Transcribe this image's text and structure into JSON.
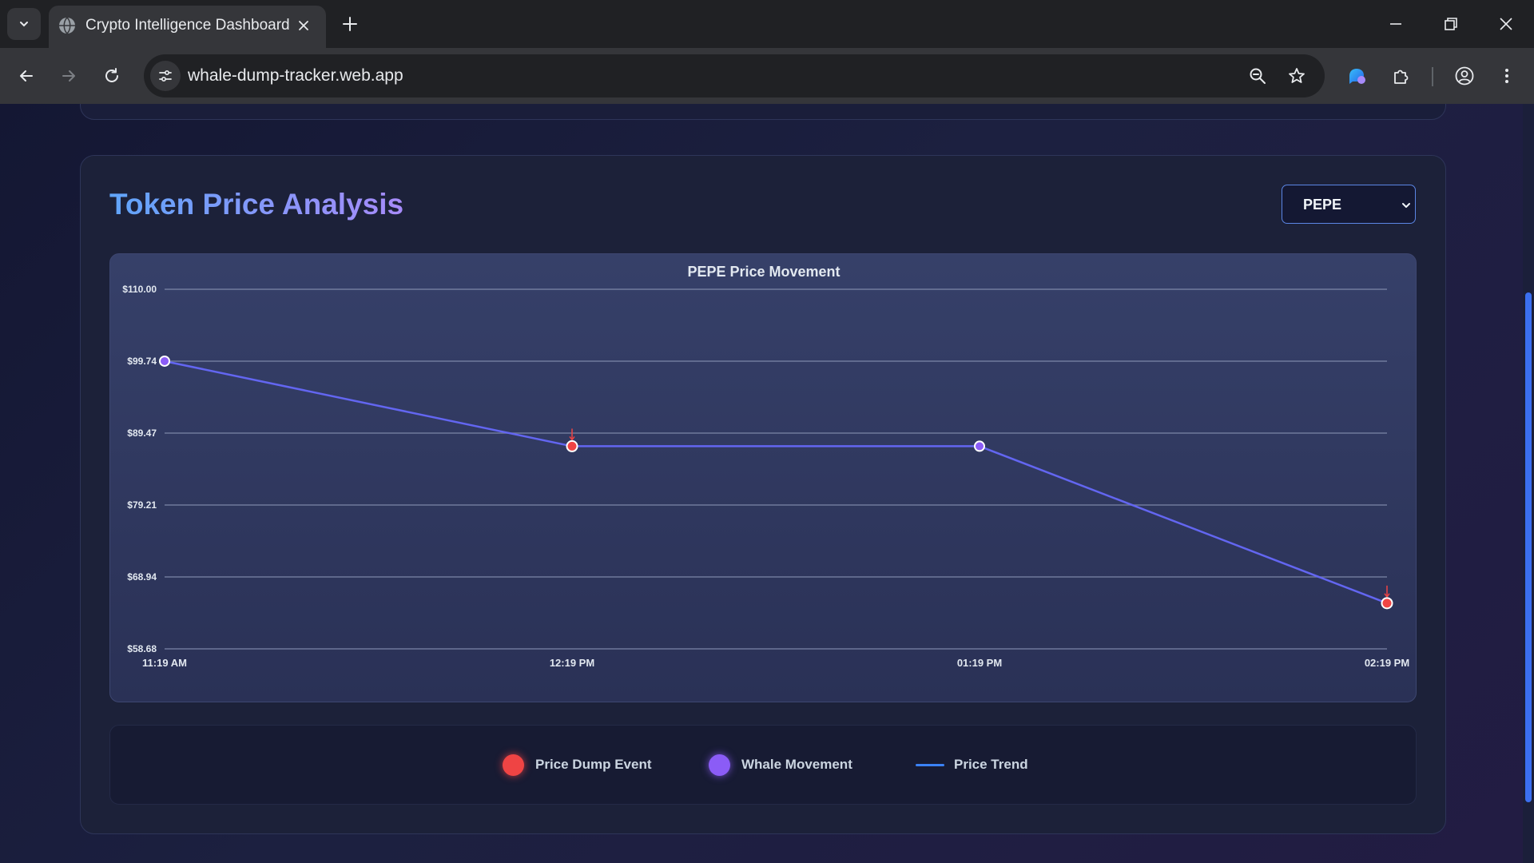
{
  "browser": {
    "tab_title": "Crypto Intelligence Dashboard",
    "url": "whale-dump-tracker.web.app"
  },
  "page": {
    "section_title": "Token Price Analysis",
    "token_select": {
      "value": "PEPE"
    }
  },
  "chart_data": {
    "type": "line",
    "title": "PEPE Price Movement",
    "x": [
      "11:19 AM",
      "12:19 PM",
      "01:19 PM",
      "02:19 PM"
    ],
    "y_ticks": [
      "$110.00",
      "$99.74",
      "$89.47",
      "$79.21",
      "$68.94",
      "$58.68"
    ],
    "ylim": [
      58.68,
      110.0
    ],
    "grid": true,
    "series": [
      {
        "values": [
          99.74,
          87.6,
          87.6,
          65.2
        ],
        "color": "#6366f1"
      }
    ],
    "events": [
      {
        "x": "11:19 AM",
        "type": "whale"
      },
      {
        "x": "12:19 PM",
        "type": "dump"
      },
      {
        "x": "01:19 PM",
        "type": "whale"
      },
      {
        "x": "02:19 PM",
        "type": "dump"
      }
    ]
  },
  "legend": {
    "items": [
      {
        "label": "Price Dump Event",
        "color": "#ef4444"
      },
      {
        "label": "Whale Movement",
        "color": "#8b5cf6"
      },
      {
        "label": "Price Trend",
        "color": "#3b82f6"
      }
    ]
  }
}
